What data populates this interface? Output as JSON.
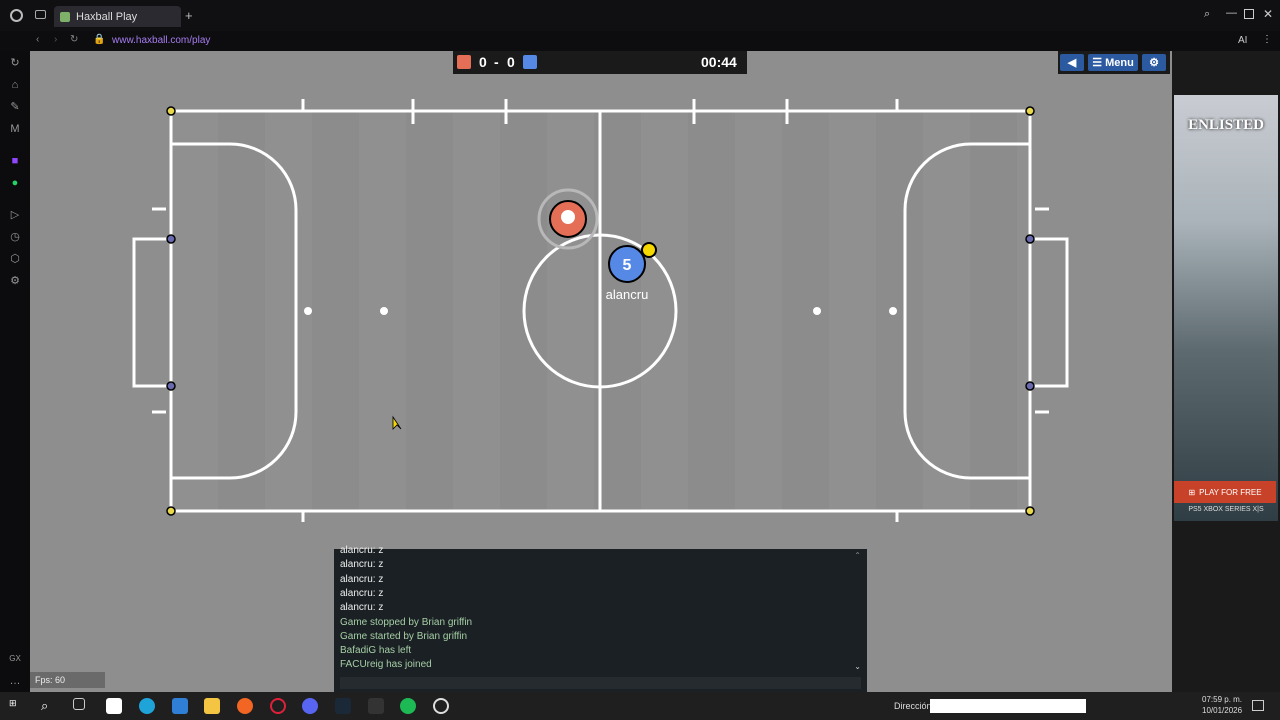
{
  "browser": {
    "tab_title": "Haxball Play",
    "url": "www.haxball.com/play",
    "toolbar_ai": "AI"
  },
  "hud": {
    "red_score": "0",
    "separator": "-",
    "blue_score": "0",
    "timer": "00:44",
    "menu_label": "Menu",
    "back_icon": "triangle-left-icon",
    "settings_icon": "gear-icon"
  },
  "players": {
    "blue_number": "5",
    "blue_name": "alancru"
  },
  "chat": {
    "lines": [
      {
        "text": "alancru: z",
        "type": "msg"
      },
      {
        "text": "alancru: z",
        "type": "msg"
      },
      {
        "text": "alancru: z",
        "type": "msg"
      },
      {
        "text": "alancru: z",
        "type": "msg"
      },
      {
        "text": "alancru: z",
        "type": "msg"
      },
      {
        "text": "Game stopped by Brian griffin",
        "type": "sys"
      },
      {
        "text": "Game started by Brian griffin",
        "type": "sys"
      },
      {
        "text": "BafadiG has left",
        "type": "sys"
      },
      {
        "text": "FACUreig has joined",
        "type": "sys"
      }
    ]
  },
  "fps": "Fps: 60",
  "ad": {
    "brand": "ENLISTED",
    "cta": "PLAY FOR FREE",
    "platforms": "PS5 XBOX SERIES X|S"
  },
  "taskbar": {
    "address_label": "Dirección",
    "time": "07:59 p. m.",
    "date": "10/01/2026"
  },
  "colors": {
    "red_team": "#e56e56",
    "blue_team": "#5689e5",
    "field": "#8e8e8e",
    "accent": "#a67cf0"
  }
}
